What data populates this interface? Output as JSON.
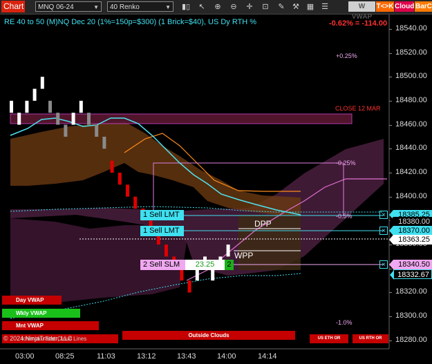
{
  "toolbar": {
    "title": "Chart",
    "instrument": "MNQ 06-24",
    "bar_type": "40 Renko",
    "icons": [
      "bars-icon",
      "cursor-icon",
      "zoom-in-icon",
      "zoom-out-icon",
      "crosshair-icon",
      "ruler-icon",
      "pencil-icon",
      "tools-icon",
      "data-box-icon",
      "properties-icon"
    ],
    "wvwap": "W VWAP",
    "tk": "T<>K",
    "cloud": "Cloud",
    "barco": "BarCo"
  },
  "header": {
    "instrument_info": "RE 40 to 50 (M)NQ Dec 20 (1%=150p=$300) (1 Brick=$40), US Dy RTH %",
    "change": "-0.62% = -114.00"
  },
  "annotations": {
    "plus_025_top": "+0.25%",
    "close_12_mar": "CLOSE 12 MAR",
    "minus_025": "-0.25%",
    "minus_05": "-0.5%",
    "minus_10": "-1.0%",
    "dpp": "DPP",
    "wpp": "WPP"
  },
  "orders": [
    {
      "label": "1 Sell LMT",
      "price": "18385.25"
    },
    {
      "label": "1 Sell LMT",
      "price": "18370.00"
    },
    {
      "label": "2 Sell SLM",
      "value": "23.25",
      "count": "2",
      "price": "18340.50"
    }
  ],
  "price_tags": {
    "current": "18363.25",
    "vwap": "18332.67",
    "dotted_line": "18380.00"
  },
  "buttons": {
    "day_vwap": "Day VWAP",
    "wkly_vwap": "Wkly VWAP",
    "mnt_vwap": "Mnt VWAP",
    "outside_clouds": "Outside Clouds",
    "us_eth_or": "US ETH OR",
    "us_rth_or": "US RTH OR"
  },
  "copyright": "© 2024 NinjaTrader, LLC",
  "ichimoku_first_cloud": "Ichimoku First Cloud Lines",
  "colors": {
    "up_brick": "#ffffff",
    "down_brick": "#e00000",
    "price_line": "#4fe3f0",
    "cloud_fill": "#6a3a12",
    "purple_cloud": "#4a1f3e",
    "accent_red": "#d9230f",
    "order_cyan": "#3fe0f0",
    "order_pink": "#f0a8f0"
  },
  "chart_data": {
    "type": "renko",
    "brick_size": 40,
    "yaxis": {
      "ticks": [
        18540.0,
        18520.0,
        18500.0,
        18480.0,
        18460.0,
        18440.0,
        18420.0,
        18400.0,
        18380.0,
        18360.0,
        18340.0,
        18320.0,
        18300.0,
        18280.0
      ],
      "labels": [
        "18540.00",
        "18520.00",
        "18500.00",
        "18480.00",
        "18460.00",
        "18440.00",
        "18420.00",
        "18400.00",
        "18380.00",
        "18360.00",
        "18340.00",
        "18320.00",
        "18300.00",
        "18280.00"
      ],
      "range": [
        18273,
        18552
      ]
    },
    "xaxis": {
      "labels": [
        "03:00",
        "08:25",
        "11:03",
        "13:12",
        "13:43",
        "14:00",
        "14:14"
      ]
    },
    "bricks": [
      {
        "o": 18470,
        "c": 18480,
        "up": true
      },
      {
        "o": 18460,
        "c": 18470,
        "up": true
      },
      {
        "o": 18470,
        "c": 18480,
        "up": true
      },
      {
        "o": 18480,
        "c": 18490,
        "up": true
      },
      {
        "o": 18490,
        "c": 18500,
        "up": true
      },
      {
        "o": 18480,
        "c": 18470,
        "up": false
      },
      {
        "o": 18470,
        "c": 18460,
        "up": false
      },
      {
        "o": 18460,
        "c": 18450,
        "up": false
      },
      {
        "o": 18460,
        "c": 18470,
        "up": true
      },
      {
        "o": 18470,
        "c": 18480,
        "up": true
      },
      {
        "o": 18470,
        "c": 18460,
        "up": false
      },
      {
        "o": 18460,
        "c": 18450,
        "up": false
      },
      {
        "o": 18450,
        "c": 18440,
        "up": false
      },
      {
        "o": 18430,
        "c": 18420,
        "up": false
      },
      {
        "o": 18420,
        "c": 18410,
        "up": false
      },
      {
        "o": 18410,
        "c": 18400,
        "up": false
      },
      {
        "o": 18400,
        "c": 18390,
        "up": false
      },
      {
        "o": 18390,
        "c": 18380,
        "up": false
      },
      {
        "o": 18380,
        "c": 18370,
        "up": false
      },
      {
        "o": 18370,
        "c": 18360,
        "up": false
      },
      {
        "o": 18360,
        "c": 18350,
        "up": false
      },
      {
        "o": 18350,
        "c": 18340,
        "up": false
      },
      {
        "o": 18340,
        "c": 18330,
        "up": false
      },
      {
        "o": 18330,
        "c": 18320,
        "up": false
      },
      {
        "o": 18330,
        "c": 18340,
        "up": true
      },
      {
        "o": 18340,
        "c": 18350,
        "up": true
      },
      {
        "o": 18330,
        "c": 18340,
        "up": true
      },
      {
        "o": 18340,
        "c": 18350,
        "up": true
      },
      {
        "o": 18350,
        "c": 18360,
        "up": true
      }
    ]
  }
}
